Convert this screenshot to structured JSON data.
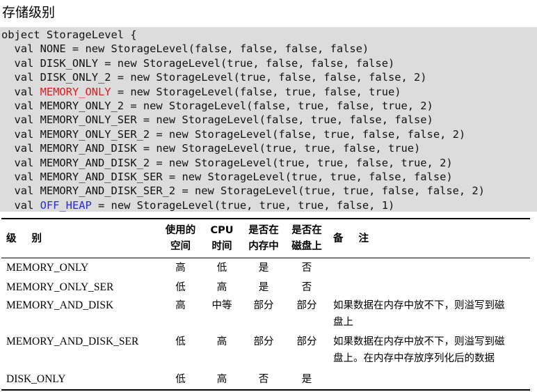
{
  "title": "存储级别",
  "code": {
    "lines": [
      {
        "pre": "object StorageLevel {",
        "hl": "",
        "post": "",
        "hl_color": ""
      },
      {
        "pre": "  val NONE = new StorageLevel(false, false, false, false)",
        "hl": "",
        "post": "",
        "hl_color": ""
      },
      {
        "pre": "  val DISK_ONLY = new StorageLevel(true, false, false, false)",
        "hl": "",
        "post": "",
        "hl_color": ""
      },
      {
        "pre": "  val DISK_ONLY_2 = new StorageLevel(true, false, false, false, 2)",
        "hl": "",
        "post": "",
        "hl_color": ""
      },
      {
        "pre": "  val ",
        "hl": "MEMORY_ONLY",
        "post": " = new StorageLevel(false, true, false, true)",
        "hl_color": "red"
      },
      {
        "pre": "  val MEMORY_ONLY_2 = new StorageLevel(false, true, false, true, 2)",
        "hl": "",
        "post": "",
        "hl_color": ""
      },
      {
        "pre": "  val MEMORY_ONLY_SER = new StorageLevel(false, true, false, false)",
        "hl": "",
        "post": "",
        "hl_color": ""
      },
      {
        "pre": "  val MEMORY_ONLY_SER_2 = new StorageLevel(false, true, false, false, 2)",
        "hl": "",
        "post": "",
        "hl_color": ""
      },
      {
        "pre": "  val MEMORY_AND_DISK = new StorageLevel(true, true, false, true)",
        "hl": "",
        "post": "",
        "hl_color": ""
      },
      {
        "pre": "  val MEMORY_AND_DISK_2 = new StorageLevel(true, true, false, true, 2)",
        "hl": "",
        "post": "",
        "hl_color": ""
      },
      {
        "pre": "  val MEMORY_AND_DISK_SER = new StorageLevel(true, true, false, false)",
        "hl": "",
        "post": "",
        "hl_color": ""
      },
      {
        "pre": "  val MEMORY_AND_DISK_SER_2 = new StorageLevel(true, true, false, false, 2)",
        "hl": "",
        "post": "",
        "hl_color": ""
      },
      {
        "pre": "  val ",
        "hl": "OFF_HEAP",
        "post": " = new StorageLevel(true, true, true, false, 1)",
        "hl_color": "blue"
      }
    ]
  },
  "colors": {
    "code_background": "#dcdcdc",
    "highlight_red": "#e0191c",
    "highlight_blue": "#2a2ad8"
  },
  "table": {
    "headers": {
      "level": "级别",
      "space_line1": "使用的",
      "space_line2": "空间",
      "cpu_line1": "CPU",
      "cpu_line2": "时间",
      "in_memory_line1": "是否在",
      "in_memory_line2": "内存中",
      "on_disk_line1": "是否在",
      "on_disk_line2": "磁盘上",
      "remark": "备注"
    },
    "rows": [
      {
        "level": "MEMORY_ONLY",
        "space": "高",
        "cpu": "低",
        "in_memory": "是",
        "on_disk": "否",
        "remark_line1": "",
        "remark_line2": ""
      },
      {
        "level": "MEMORY_ONLY_SER",
        "space": "低",
        "cpu": "高",
        "in_memory": "是",
        "on_disk": "否",
        "remark_line1": "",
        "remark_line2": ""
      },
      {
        "level": "MEMORY_AND_DISK",
        "space": "高",
        "cpu": "中等",
        "in_memory": "部分",
        "on_disk": "部分",
        "remark_line1": "如果数据在内存中放不下，则溢写到磁",
        "remark_line2": "盘上"
      },
      {
        "level": "MEMORY_AND_DISK_SER",
        "space": "低",
        "cpu": "高",
        "in_memory": "部分",
        "on_disk": "部分",
        "remark_line1": "如果数据在内存中放不下，则溢写到磁",
        "remark_line2": "盘上。在内存中存放序列化后的数据"
      },
      {
        "level": "DISK_ONLY",
        "space": "低",
        "cpu": "高",
        "in_memory": "否",
        "on_disk": "是",
        "remark_line1": "",
        "remark_line2": ""
      }
    ]
  }
}
